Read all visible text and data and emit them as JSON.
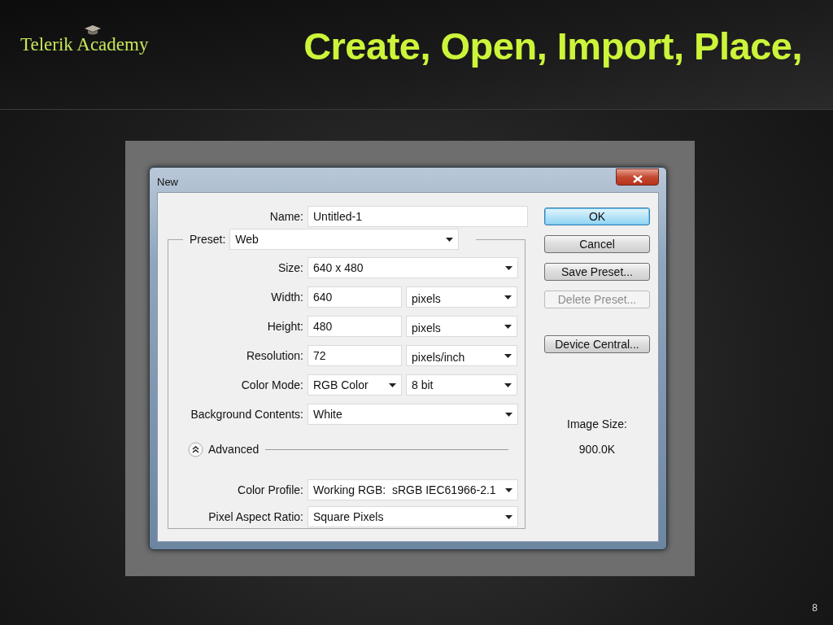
{
  "slide": {
    "logo": "Telerik Academy",
    "title": "Create, Open, Import, Place,",
    "page_number": "8"
  },
  "dialog": {
    "title": "New",
    "name": {
      "label": "Name:",
      "value": "Untitled-1"
    },
    "preset": {
      "label": "Preset:",
      "value": "Web"
    },
    "fields": [
      {
        "label": "Size:",
        "kind": "select",
        "value": "640 x 480"
      },
      {
        "label": "Width:",
        "kind": "input_unit",
        "value": "640",
        "unit": "pixels"
      },
      {
        "label": "Height:",
        "kind": "input_unit",
        "value": "480",
        "unit": "pixels"
      },
      {
        "label": "Resolution:",
        "kind": "input_unit",
        "value": "72",
        "unit": "pixels/inch"
      },
      {
        "label": "Color Mode:",
        "kind": "select_pair",
        "value": "RGB Color",
        "unit": "8 bit"
      },
      {
        "label": "Background Contents:",
        "kind": "select",
        "value": "White"
      }
    ],
    "advanced": {
      "label": "Advanced",
      "expanded": true
    },
    "advanced_fields": [
      {
        "label": "Color Profile:",
        "kind": "select",
        "value": "Working RGB:  sRGB IEC61966-2.1"
      },
      {
        "label": "Pixel Aspect Ratio:",
        "kind": "select",
        "value": "Square Pixels"
      }
    ],
    "buttons": [
      {
        "label": "OK",
        "kind": "action",
        "default": true,
        "disabled": false
      },
      {
        "label": "Cancel",
        "kind": "action",
        "default": false,
        "disabled": false
      },
      {
        "label": "Save Preset...",
        "kind": "action",
        "default": false,
        "disabled": false
      },
      {
        "label": "Delete Preset...",
        "kind": "action",
        "default": false,
        "disabled": true
      },
      {
        "label": "Device Central...",
        "kind": "tool",
        "default": false,
        "disabled": false
      }
    ],
    "image_size": {
      "label": "Image Size:",
      "value": "900.0K"
    }
  }
}
